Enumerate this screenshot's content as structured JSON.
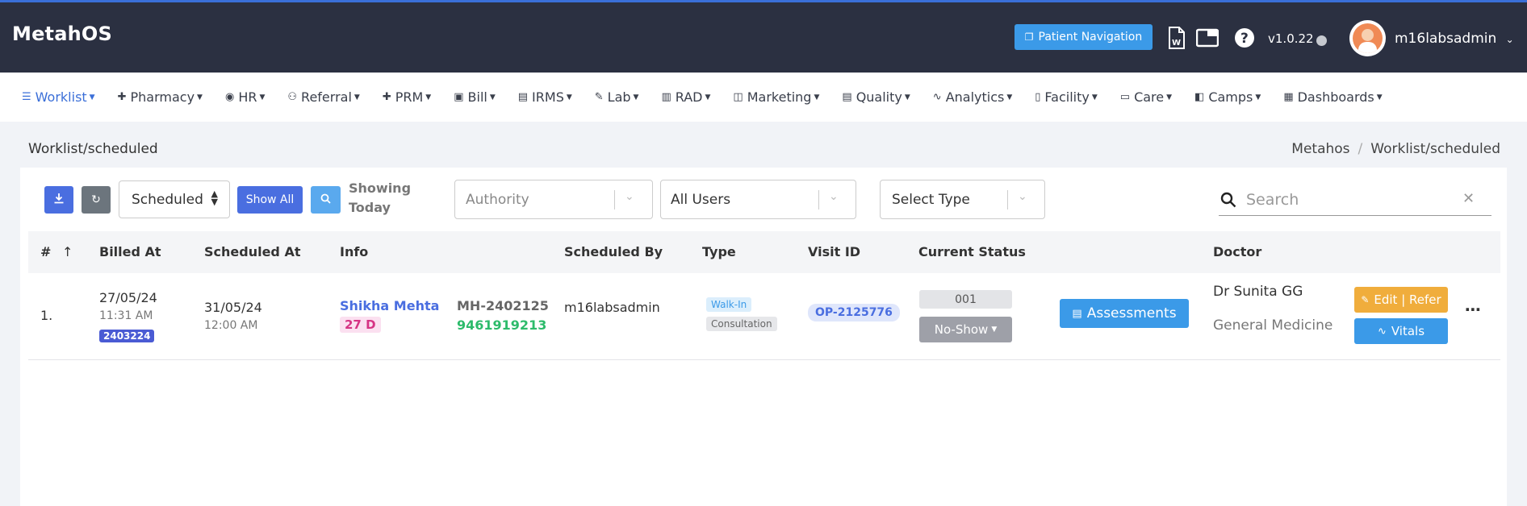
{
  "header": {
    "brand": "MetahOS",
    "patient_nav_label": "Patient Navigation",
    "version": "v1.0.22",
    "username": "m16labsadmin"
  },
  "nav": {
    "items": [
      {
        "label": "Worklist",
        "icon": "list-icon",
        "glyph": "☰"
      },
      {
        "label": "Pharmacy",
        "icon": "plus-icon",
        "glyph": "✚"
      },
      {
        "label": "HR",
        "icon": "user-circle-icon",
        "glyph": "◉"
      },
      {
        "label": "Referral",
        "icon": "users-icon",
        "glyph": "⚇"
      },
      {
        "label": "PRM",
        "icon": "plus-icon",
        "glyph": "✚"
      },
      {
        "label": "Bill",
        "icon": "money-icon",
        "glyph": "▣"
      },
      {
        "label": "IRMS",
        "icon": "card-icon",
        "glyph": "▤"
      },
      {
        "label": "Lab",
        "icon": "pen-icon",
        "glyph": "✎"
      },
      {
        "label": "RAD",
        "icon": "film-icon",
        "glyph": "▥"
      },
      {
        "label": "Marketing",
        "icon": "bag-icon",
        "glyph": "◫"
      },
      {
        "label": "Quality",
        "icon": "id-card-icon",
        "glyph": "▤"
      },
      {
        "label": "Analytics",
        "icon": "pulse-icon",
        "glyph": "∿"
      },
      {
        "label": "Facility",
        "icon": "building-icon",
        "glyph": "▯"
      },
      {
        "label": "Care",
        "icon": "ambulance-icon",
        "glyph": "▭"
      },
      {
        "label": "Camps",
        "icon": "briefcase-icon",
        "glyph": "◧"
      },
      {
        "label": "Dashboards",
        "icon": "grid-icon",
        "glyph": "▦"
      }
    ]
  },
  "page": {
    "title": "Worklist/scheduled",
    "breadcrumb": [
      "Metahos",
      "Worklist/scheduled"
    ]
  },
  "toolbar": {
    "status_select": "Scheduled",
    "show_all_label": "Show All",
    "showing_line1": "Showing",
    "showing_line2": "Today",
    "authority_placeholder": "Authority",
    "users_value": "All Users",
    "type_value": "Select Type",
    "search_placeholder": "Search"
  },
  "table": {
    "headers": {
      "num": "#",
      "billed_at": "Billed At",
      "scheduled_at": "Scheduled At",
      "info": "Info",
      "scheduled_by": "Scheduled By",
      "type": "Type",
      "visit_id": "Visit ID",
      "current_status": "Current Status",
      "doctor": "Doctor"
    },
    "rows": [
      {
        "index": "1.",
        "billed_date": "27/05/24",
        "billed_time": "11:31 AM",
        "bill_no": "2403224",
        "scheduled_date": "31/05/24",
        "scheduled_time": "12:00 AM",
        "patient_name": "Shikha Mehta",
        "patient_age": "27 D",
        "mrn": "MH-2402125",
        "phone": "9461919213",
        "scheduled_by": "m16labsadmin",
        "type_tag1": "Walk-In",
        "type_tag2": "Consultation",
        "visit_id": "OP-2125776",
        "token": "001",
        "status": "No-Show",
        "assessments_label": "Assessments",
        "doctor_name": "Dr Sunita GG",
        "department": "General Medicine",
        "edit_label": "Edit | Refer",
        "vitals_label": "Vitals"
      }
    ]
  },
  "colors": {
    "header_bg": "#2b3041",
    "accent_blue": "#3b9ae8",
    "indigo": "#4a5bd4",
    "orange": "#f0ad3c",
    "green": "#2dbb6b",
    "magenta": "#d63384"
  }
}
